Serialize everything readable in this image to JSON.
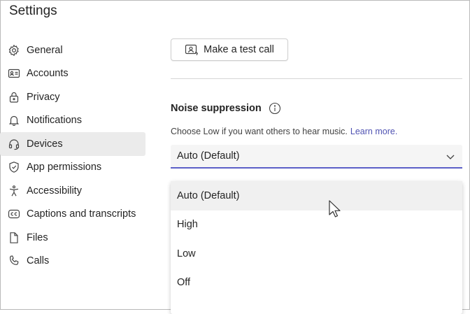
{
  "window": {
    "title": "Settings"
  },
  "sidebar": {
    "items": [
      {
        "label": "General",
        "icon": "gear-icon"
      },
      {
        "label": "Accounts",
        "icon": "id-card-icon"
      },
      {
        "label": "Privacy",
        "icon": "lock-icon"
      },
      {
        "label": "Notifications",
        "icon": "bell-icon"
      },
      {
        "label": "Devices",
        "icon": "headset-icon",
        "active": true
      },
      {
        "label": "App permissions",
        "icon": "shield-icon"
      },
      {
        "label": "Accessibility",
        "icon": "accessibility-icon"
      },
      {
        "label": "Captions and transcripts",
        "icon": "closed-captions-icon"
      },
      {
        "label": "Files",
        "icon": "file-icon"
      },
      {
        "label": "Calls",
        "icon": "phone-icon"
      }
    ]
  },
  "main": {
    "test_call_label": "Make a test call",
    "noise_suppression": {
      "title": "Noise suppression",
      "helper": "Choose Low if you want others to hear music.",
      "learn_more": "Learn more.",
      "selected": "Auto (Default)",
      "options": [
        "Auto (Default)",
        "High",
        "Low",
        "Off"
      ],
      "hovered_option": "Auto (Default)"
    }
  },
  "colors": {
    "accent": "#5b5fc7",
    "link": "#4f52b2",
    "active_bg": "#ebebeb"
  }
}
